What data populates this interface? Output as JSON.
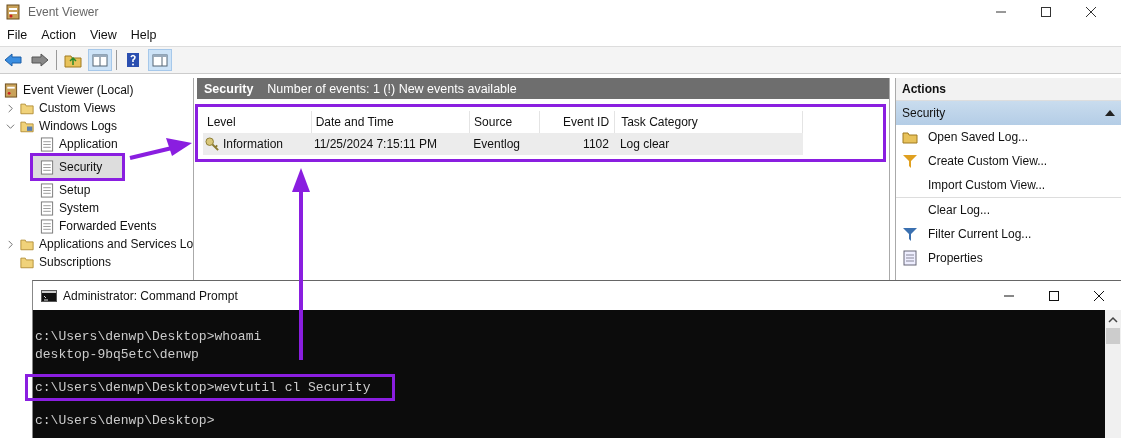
{
  "window": {
    "title": "Event Viewer"
  },
  "menu": [
    "File",
    "Action",
    "View",
    "Help"
  ],
  "tree": [
    {
      "label": "Event Viewer (Local)",
      "selected": false,
      "children": [
        {
          "label": "Custom Views",
          "expanded": false,
          "selected": false
        },
        {
          "label": "Windows Logs",
          "expanded": true,
          "selected": false,
          "children": [
            {
              "label": "Application",
              "selected": false,
              "highlighted": false
            },
            {
              "label": "Security",
              "selected": true,
              "highlighted": true
            },
            {
              "label": "Setup",
              "selected": false,
              "highlighted": false
            },
            {
              "label": "System",
              "selected": false,
              "highlighted": false
            },
            {
              "label": "Forwarded Events",
              "selected": false,
              "highlighted": false
            }
          ]
        },
        {
          "label": "Applications and Services Lo",
          "expanded": false,
          "selected": false
        },
        {
          "label": "Subscriptions",
          "selected": false
        }
      ]
    }
  ],
  "log": {
    "title": "Security",
    "summary": "Number of events: 1 (!) New events available",
    "highlighted": true,
    "columns": [
      "Level",
      "Date and Time",
      "Source",
      "Event ID",
      "Task Category"
    ],
    "rows": [
      {
        "level": "Information",
        "date": "11/25/2024 7:15:11 PM",
        "source": "Eventlog",
        "event_id": "1102",
        "task_category": "Log clear",
        "selected": true
      }
    ]
  },
  "actions": {
    "title": "Actions",
    "section": "Security",
    "items": [
      {
        "label": "Open Saved Log...",
        "separator_before": false
      },
      {
        "label": "Create Custom View...",
        "separator_before": false
      },
      {
        "label": "Import Custom View...",
        "separator_before": false
      },
      {
        "label": "Clear Log...",
        "separator_before": true
      },
      {
        "label": "Filter Current Log...",
        "separator_before": false
      },
      {
        "label": "Properties",
        "separator_before": false
      }
    ]
  },
  "console": {
    "title": "Administrator: Command Prompt",
    "lines": [
      {
        "text": "c:\\Users\\denwp\\Desktop>whoami",
        "highlighted": false,
        "gap_before": true
      },
      {
        "text": "desktop-9bq5etc\\denwp",
        "highlighted": false,
        "gap_before": false
      },
      {
        "text": "c:\\Users\\denwp\\Desktop>wevtutil cl Security",
        "highlighted": true,
        "gap_before": true
      },
      {
        "text": "c:\\Users\\denwp\\Desktop>",
        "highlighted": false,
        "gap_before": true
      }
    ]
  }
}
